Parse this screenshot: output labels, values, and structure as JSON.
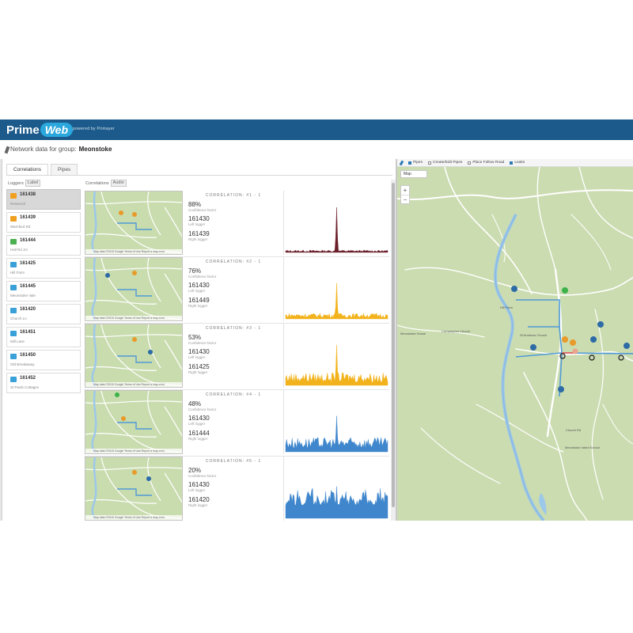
{
  "app": {
    "logo_prime": "Prime",
    "logo_web": "Web",
    "powered_by": "powered by Primayer"
  },
  "header": {
    "label": "Network data for group:",
    "group": "Meonstoke"
  },
  "tabs": [
    {
      "label": "Correlations",
      "active": true
    },
    {
      "label": "Pipes",
      "active": false
    }
  ],
  "loggers_toggle": {
    "label": "Loggers",
    "button": "Label"
  },
  "correlations_toggle": {
    "label": "Correlations",
    "button": "Audio"
  },
  "loggers": [
    {
      "id": "161438",
      "sub": "Reservoir",
      "color": "#f0a020",
      "selected": true
    },
    {
      "id": "161439",
      "sub": "Warnford Rd",
      "color": "#f0a020",
      "selected": false
    },
    {
      "id": "161444",
      "sub": "Hall Rd Jct",
      "color": "#4caf50",
      "selected": false
    },
    {
      "id": "161425",
      "sub": "Hill Farm",
      "color": "#3aa0d8",
      "selected": false
    },
    {
      "id": "161445",
      "sub": "Meonstoke Vale",
      "color": "#3aa0d8",
      "selected": false
    },
    {
      "id": "161420",
      "sub": "Church Ln",
      "color": "#3aa0d8",
      "selected": false
    },
    {
      "id": "161451",
      "sub": "Mill Lane",
      "color": "#3aa0d8",
      "selected": false
    },
    {
      "id": "161450",
      "sub": "Old Breakaway",
      "color": "#3aa0d8",
      "selected": false
    },
    {
      "id": "161452",
      "sub": "St Pauls Cottages",
      "color": "#3aa0d8",
      "selected": false
    }
  ],
  "correlations": [
    {
      "title": "CORRELATION: #1 - 1",
      "percent": "88%",
      "cf_label": "Confidence factor",
      "left": "161430",
      "left_label": "Left logger",
      "right": "161439",
      "right_label": "Right logger",
      "color": "#6b1f2a",
      "peak": 0.5
    },
    {
      "title": "CORRELATION: #2 - 1",
      "percent": "76%",
      "cf_label": "Confidence factor",
      "left": "161430",
      "left_label": "Left logger",
      "right": "161449",
      "right_label": "Right logger",
      "color": "#f2b21b",
      "peak": 0.5
    },
    {
      "title": "CORRELATION: #3 - 1",
      "percent": "53%",
      "cf_label": "Confidence factor",
      "left": "161430",
      "left_label": "Left logger",
      "right": "161425",
      "right_label": "Right logger",
      "color": "#f2b21b",
      "peak": 0.53
    },
    {
      "title": "CORRELATION: #4 - 1",
      "percent": "48%",
      "cf_label": "Confidence factor",
      "left": "161430",
      "left_label": "Left logger",
      "right": "161444",
      "right_label": "Right logger",
      "color": "#3f86cc",
      "peak": 0.5
    },
    {
      "title": "CORRELATION: #5 - 1",
      "percent": "20%",
      "cf_label": "Confidence factor",
      "left": "161430",
      "left_label": "Left logger",
      "right": "161420",
      "right_label": "Right logger",
      "color": "#3f86cc",
      "peak": 0.5
    }
  ],
  "minimap_attr": "Map data ©2015 Google   Terms of Use   Report a map error",
  "map_toolbar": [
    {
      "label": "Pipes",
      "checked": true
    },
    {
      "label": "Create/Edit Pipes",
      "checked": false
    },
    {
      "label": "Place Follow Road",
      "checked": false
    },
    {
      "label": "Leaks",
      "checked": true
    }
  ],
  "map": {
    "type_select": "Map",
    "zoom_in": "+",
    "zoom_out": "−",
    "labels": [
      "Corhampton Church",
      "Meonstoke House",
      "St Andrews Church",
      "Hill Farm",
      "Meonstoke Infant School",
      "Church Rd"
    ]
  }
}
